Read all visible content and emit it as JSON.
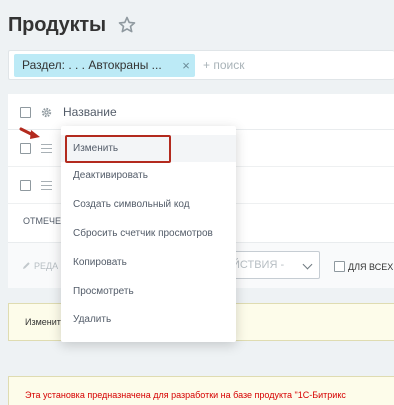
{
  "page": {
    "title": "Продукты"
  },
  "filter": {
    "chip_label": "Раздел: . . . Автокраны ...",
    "chip_close": "×",
    "search_placeholder": "+ поиск"
  },
  "grid": {
    "column_title": "Название",
    "marked_label": "ОТМЕЧЕ"
  },
  "actions": {
    "edit_label": "РЕДА",
    "select_value": "ЙСТВИЯ -",
    "for_all_label": "ДЛЯ ВСЕХ"
  },
  "context_menu": {
    "items": [
      {
        "label": "Изменить"
      },
      {
        "label": "Деактивировать"
      },
      {
        "label": "Создать символьный код"
      },
      {
        "label": "Сбросить счетчик просмотров"
      },
      {
        "label": "Копировать"
      },
      {
        "label": "Просмотреть"
      },
      {
        "label": "Удалить"
      }
    ]
  },
  "notices": {
    "info_text": "Изменит                                                    мационному блоку вы можете в",
    "warning_text": "Эта установка предназначена для разработки на базе продукта \"1С-Битрикс"
  },
  "colors": {
    "chip_bg": "#bceaf6",
    "highlight_border": "#b32a1e",
    "warning_text": "#d60000",
    "notice_bg": "#fdfcea"
  }
}
